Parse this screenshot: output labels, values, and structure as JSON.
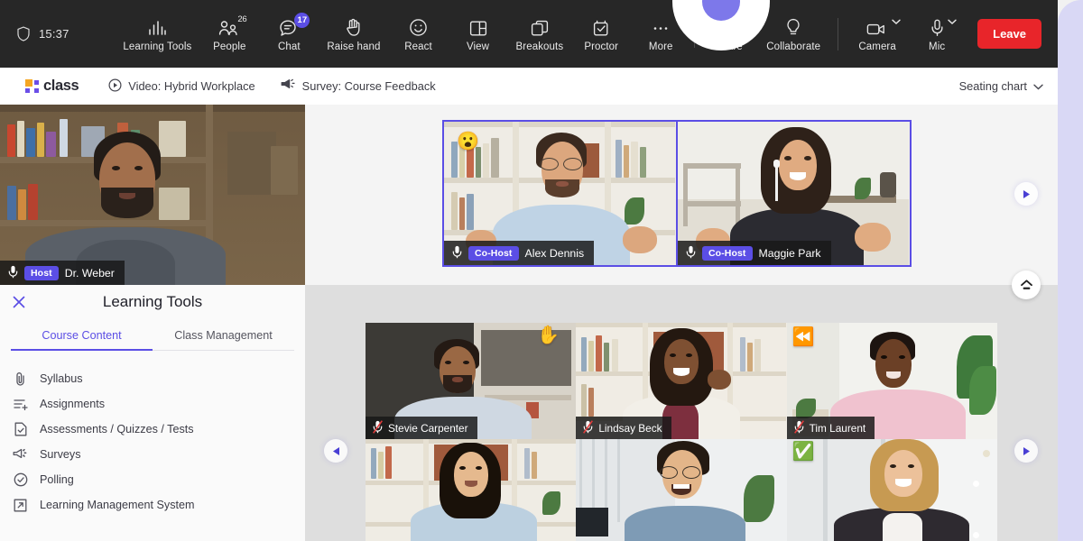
{
  "toolbar": {
    "clock": "15:37",
    "shield_icon": "shield-icon",
    "items": [
      {
        "id": "learning-tools",
        "label": "Learning Tools",
        "icon": "bars-icon",
        "badge": null,
        "badge_style": null
      },
      {
        "id": "people",
        "label": "People",
        "icon": "people-icon",
        "badge": "26",
        "badge_style": "plain"
      },
      {
        "id": "chat",
        "label": "Chat",
        "icon": "chat-bubble-icon",
        "badge": "17",
        "badge_style": "dot"
      },
      {
        "id": "raise-hand",
        "label": "Raise hand",
        "icon": "hand-icon",
        "badge": null,
        "badge_style": null
      },
      {
        "id": "react",
        "label": "React",
        "icon": "smiley-icon",
        "badge": null,
        "badge_style": null
      },
      {
        "id": "view",
        "label": "View",
        "icon": "layout-icon",
        "badge": null,
        "badge_style": null
      },
      {
        "id": "breakouts",
        "label": "Breakouts",
        "icon": "breakout-rooms-icon",
        "badge": null,
        "badge_style": null
      },
      {
        "id": "proctor",
        "label": "Proctor",
        "icon": "checklist-icon",
        "badge": null,
        "badge_style": null
      },
      {
        "id": "more",
        "label": "More",
        "icon": "more-icon",
        "badge": null,
        "badge_style": null
      },
      {
        "id": "share",
        "label": "Share",
        "icon": "share-upload-icon",
        "badge": null,
        "badge_style": null
      },
      {
        "id": "collaborate",
        "label": "Collaborate",
        "icon": "lightbulb-icon",
        "badge": null,
        "badge_style": null
      }
    ],
    "device_items": [
      {
        "id": "camera",
        "label": "Camera",
        "icon": "camera-icon"
      },
      {
        "id": "mic",
        "label": "Mic",
        "icon": "microphone-icon"
      }
    ],
    "leave_label": "Leave",
    "leave_color": "#e8252a",
    "accent_color": "#5b4ee5",
    "background": "#272727"
  },
  "subnav": {
    "logo_text": "class",
    "items": [
      {
        "id": "video",
        "label": "Video: Hybrid Workplace",
        "icon": "play-circle-icon"
      },
      {
        "id": "survey",
        "label": "Survey: Course Feedback",
        "icon": "megaphone-icon"
      }
    ],
    "right": {
      "label": "Seating chart",
      "icon": "chevron-down-icon"
    }
  },
  "host_tile": {
    "name": "Dr. Weber",
    "role_chip": "Host",
    "mic_icon": "microphone-icon",
    "mic_muted": false
  },
  "featured": [
    {
      "name": "Alex Dennis",
      "role_chip": "Co-Host",
      "mic_icon": "microphone-icon",
      "mic_muted": false,
      "reaction": "😮"
    },
    {
      "name": "Maggie Park",
      "role_chip": "Co-Host",
      "mic_icon": "microphone-icon",
      "mic_muted": false,
      "reaction": null
    }
  ],
  "participants": [
    {
      "name": "Stevie Carpenter",
      "mic_icon": "microphone-muted-icon",
      "mic_muted": true,
      "reaction": "✋"
    },
    {
      "name": "Lindsay Beck",
      "mic_icon": "microphone-muted-icon",
      "mic_muted": true,
      "reaction": null
    },
    {
      "name": "Tim Laurent",
      "mic_icon": "microphone-muted-icon",
      "mic_muted": true,
      "reaction": "⏪"
    },
    {
      "name": "",
      "mic_icon": null,
      "mic_muted": false,
      "reaction": null
    },
    {
      "name": "",
      "mic_icon": null,
      "mic_muted": false,
      "reaction": null
    },
    {
      "name": "",
      "mic_icon": null,
      "mic_muted": false,
      "reaction": "✅"
    }
  ],
  "learning_tools": {
    "title": "Learning Tools",
    "close_icon": "close-icon",
    "tabs": [
      {
        "id": "course-content",
        "label": "Course Content",
        "active": true
      },
      {
        "id": "class-management",
        "label": "Class Management",
        "active": false
      }
    ],
    "items": [
      {
        "id": "syllabus",
        "label": "Syllabus",
        "icon": "paperclip-icon"
      },
      {
        "id": "assignments",
        "label": "Assignments",
        "icon": "list-add-icon"
      },
      {
        "id": "assessments",
        "label": "Assessments / Quizzes / Tests",
        "icon": "document-check-icon"
      },
      {
        "id": "surveys",
        "label": "Surveys",
        "icon": "megaphone-icon"
      },
      {
        "id": "polling",
        "label": "Polling",
        "icon": "check-circle-icon"
      },
      {
        "id": "lms",
        "label": "Learning Management System",
        "icon": "external-link-icon"
      }
    ]
  },
  "stage_controls": {
    "featured_next_icon": "play-right-icon",
    "collapse_icon": "collapse-up-icon",
    "grid_prev_icon": "play-left-icon",
    "grid_next_icon": "play-right-icon"
  }
}
